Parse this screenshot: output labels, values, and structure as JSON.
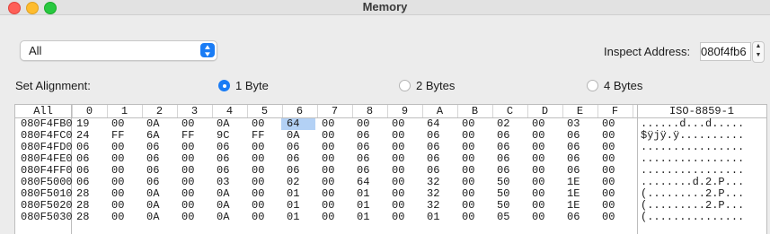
{
  "window": {
    "title": "Memory"
  },
  "popup": {
    "value": "All"
  },
  "inspect": {
    "label": "Inspect Address:",
    "value": "080f4fb6"
  },
  "alignment": {
    "label": "Set Alignment:",
    "options": [
      {
        "label": "1 Byte",
        "selected": true
      },
      {
        "label": "2 Bytes",
        "selected": false
      },
      {
        "label": "4 Bytes",
        "selected": false
      }
    ]
  },
  "table": {
    "headers": [
      "All",
      "0",
      "1",
      "2",
      "3",
      "4",
      "5",
      "6",
      "7",
      "8",
      "9",
      "A",
      "B",
      "C",
      "D",
      "E",
      "F",
      "ISO-8859-1"
    ],
    "highlight": {
      "row": 0,
      "col": 6
    },
    "rows": [
      {
        "addr": "080F4FB0",
        "bytes": [
          "19",
          "00",
          "0A",
          "00",
          "0A",
          "00",
          "64",
          "00",
          "00",
          "00",
          "64",
          "00",
          "02",
          "00",
          "03",
          "00"
        ],
        "iso": "......d...d....."
      },
      {
        "addr": "080F4FC0",
        "bytes": [
          "24",
          "FF",
          "6A",
          "FF",
          "9C",
          "FF",
          "0A",
          "00",
          "06",
          "00",
          "06",
          "00",
          "06",
          "00",
          "06",
          "00"
        ],
        "iso": "$ÿjÿ.ÿ.........."
      },
      {
        "addr": "080F4FD0",
        "bytes": [
          "06",
          "00",
          "06",
          "00",
          "06",
          "00",
          "06",
          "00",
          "06",
          "00",
          "06",
          "00",
          "06",
          "00",
          "06",
          "00"
        ],
        "iso": "................"
      },
      {
        "addr": "080F4FE0",
        "bytes": [
          "06",
          "00",
          "06",
          "00",
          "06",
          "00",
          "06",
          "00",
          "06",
          "00",
          "06",
          "00",
          "06",
          "00",
          "06",
          "00"
        ],
        "iso": "................"
      },
      {
        "addr": "080F4FF0",
        "bytes": [
          "06",
          "00",
          "06",
          "00",
          "06",
          "00",
          "06",
          "00",
          "06",
          "00",
          "06",
          "00",
          "06",
          "00",
          "06",
          "00"
        ],
        "iso": "................"
      },
      {
        "addr": "080F5000",
        "bytes": [
          "06",
          "00",
          "06",
          "00",
          "03",
          "00",
          "02",
          "00",
          "64",
          "00",
          "32",
          "00",
          "50",
          "00",
          "1E",
          "00"
        ],
        "iso": "........d.2.P..."
      },
      {
        "addr": "080F5010",
        "bytes": [
          "28",
          "00",
          "0A",
          "00",
          "0A",
          "00",
          "01",
          "00",
          "01",
          "00",
          "32",
          "00",
          "50",
          "00",
          "1E",
          "00"
        ],
        "iso": "(.........2.P..."
      },
      {
        "addr": "080F5020",
        "bytes": [
          "28",
          "00",
          "0A",
          "00",
          "0A",
          "00",
          "01",
          "00",
          "01",
          "00",
          "32",
          "00",
          "50",
          "00",
          "1E",
          "00"
        ],
        "iso": "(.........2.P..."
      },
      {
        "addr": "080F5030",
        "bytes": [
          "28",
          "00",
          "0A",
          "00",
          "0A",
          "00",
          "01",
          "00",
          "01",
          "00",
          "01",
          "00",
          "05",
          "00",
          "06",
          "00"
        ],
        "iso": "(..............."
      }
    ]
  }
}
